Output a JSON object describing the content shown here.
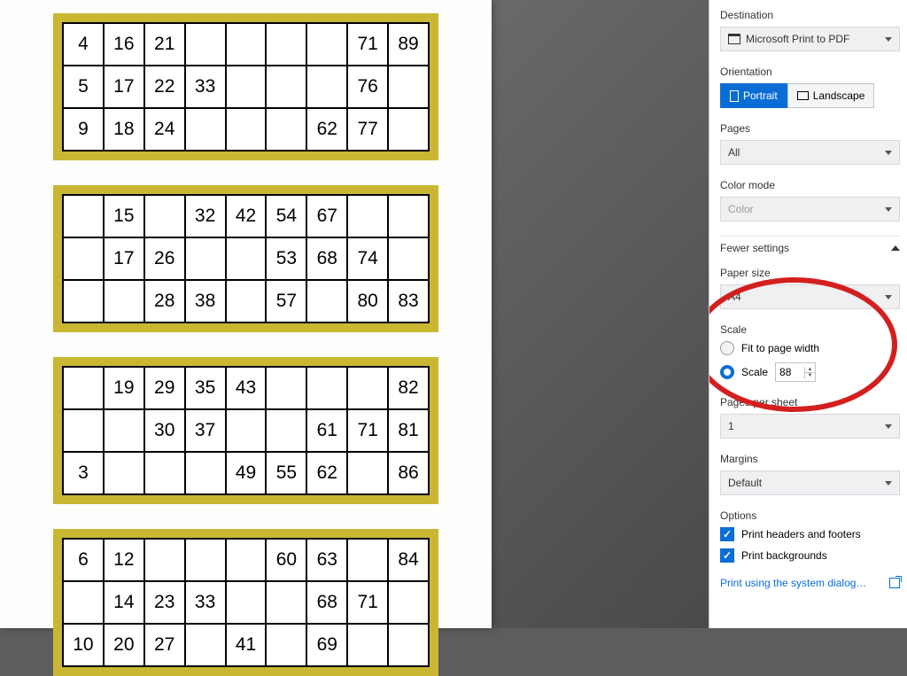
{
  "cards": [
    [
      [
        "4",
        "16",
        "21",
        "",
        "",
        "",
        "",
        "71",
        "89"
      ],
      [
        "5",
        "17",
        "22",
        "33",
        "",
        "",
        "",
        "76",
        ""
      ],
      [
        "9",
        "18",
        "24",
        "",
        "",
        "",
        "62",
        "77",
        ""
      ]
    ],
    [
      [
        "",
        "15",
        "",
        "32",
        "42",
        "54",
        "67",
        "",
        ""
      ],
      [
        "",
        "17",
        "26",
        "",
        "",
        "53",
        "68",
        "74",
        ""
      ],
      [
        "",
        "",
        "28",
        "38",
        "",
        "57",
        "",
        "80",
        "83"
      ]
    ],
    [
      [
        "",
        "19",
        "29",
        "35",
        "43",
        "",
        "",
        "",
        "82"
      ],
      [
        "",
        "",
        "30",
        "37",
        "",
        "",
        "61",
        "71",
        "81"
      ],
      [
        "3",
        "",
        "",
        "",
        "49",
        "55",
        "62",
        "",
        "86"
      ]
    ],
    [
      [
        "6",
        "12",
        "",
        "",
        "",
        "60",
        "63",
        "",
        "84"
      ],
      [
        "",
        "14",
        "23",
        "33",
        "",
        "",
        "68",
        "71",
        ""
      ],
      [
        "10",
        "20",
        "27",
        "",
        "41",
        "",
        "69",
        "",
        ""
      ]
    ]
  ],
  "panel": {
    "destination": {
      "label": "Destination",
      "value": "Microsoft Print to PDF"
    },
    "orientation": {
      "label": "Orientation",
      "portrait": "Portrait",
      "landscape": "Landscape"
    },
    "pages": {
      "label": "Pages",
      "value": "All"
    },
    "color_mode": {
      "label": "Color mode",
      "value": "Color"
    },
    "fewer_settings": "Fewer settings",
    "paper_size": {
      "label": "Paper size",
      "value": "A4"
    },
    "scale": {
      "label": "Scale",
      "fit": "Fit to page width",
      "scale_label": "Scale",
      "value": "88"
    },
    "pages_per_sheet": {
      "label": "Pages per sheet",
      "value": "1"
    },
    "margins": {
      "label": "Margins",
      "value": "Default"
    },
    "options": {
      "label": "Options",
      "headers": "Print headers and footers",
      "backgrounds": "Print backgrounds"
    },
    "system_dialog": "Print using the system dialog…"
  }
}
